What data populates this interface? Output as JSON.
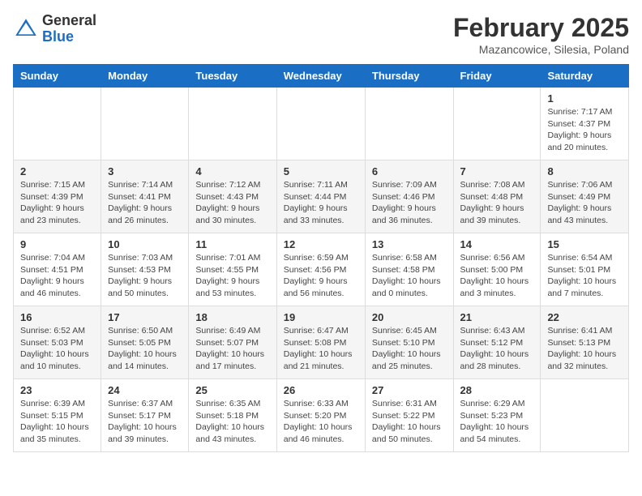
{
  "header": {
    "logo_general": "General",
    "logo_blue": "Blue",
    "month_title": "February 2025",
    "location": "Mazancowice, Silesia, Poland"
  },
  "weekdays": [
    "Sunday",
    "Monday",
    "Tuesday",
    "Wednesday",
    "Thursday",
    "Friday",
    "Saturday"
  ],
  "weeks": [
    [
      {
        "day": "",
        "text": ""
      },
      {
        "day": "",
        "text": ""
      },
      {
        "day": "",
        "text": ""
      },
      {
        "day": "",
        "text": ""
      },
      {
        "day": "",
        "text": ""
      },
      {
        "day": "",
        "text": ""
      },
      {
        "day": "1",
        "text": "Sunrise: 7:17 AM\nSunset: 4:37 PM\nDaylight: 9 hours and 20 minutes."
      }
    ],
    [
      {
        "day": "2",
        "text": "Sunrise: 7:15 AM\nSunset: 4:39 PM\nDaylight: 9 hours and 23 minutes."
      },
      {
        "day": "3",
        "text": "Sunrise: 7:14 AM\nSunset: 4:41 PM\nDaylight: 9 hours and 26 minutes."
      },
      {
        "day": "4",
        "text": "Sunrise: 7:12 AM\nSunset: 4:43 PM\nDaylight: 9 hours and 30 minutes."
      },
      {
        "day": "5",
        "text": "Sunrise: 7:11 AM\nSunset: 4:44 PM\nDaylight: 9 hours and 33 minutes."
      },
      {
        "day": "6",
        "text": "Sunrise: 7:09 AM\nSunset: 4:46 PM\nDaylight: 9 hours and 36 minutes."
      },
      {
        "day": "7",
        "text": "Sunrise: 7:08 AM\nSunset: 4:48 PM\nDaylight: 9 hours and 39 minutes."
      },
      {
        "day": "8",
        "text": "Sunrise: 7:06 AM\nSunset: 4:49 PM\nDaylight: 9 hours and 43 minutes."
      }
    ],
    [
      {
        "day": "9",
        "text": "Sunrise: 7:04 AM\nSunset: 4:51 PM\nDaylight: 9 hours and 46 minutes."
      },
      {
        "day": "10",
        "text": "Sunrise: 7:03 AM\nSunset: 4:53 PM\nDaylight: 9 hours and 50 minutes."
      },
      {
        "day": "11",
        "text": "Sunrise: 7:01 AM\nSunset: 4:55 PM\nDaylight: 9 hours and 53 minutes."
      },
      {
        "day": "12",
        "text": "Sunrise: 6:59 AM\nSunset: 4:56 PM\nDaylight: 9 hours and 56 minutes."
      },
      {
        "day": "13",
        "text": "Sunrise: 6:58 AM\nSunset: 4:58 PM\nDaylight: 10 hours and 0 minutes."
      },
      {
        "day": "14",
        "text": "Sunrise: 6:56 AM\nSunset: 5:00 PM\nDaylight: 10 hours and 3 minutes."
      },
      {
        "day": "15",
        "text": "Sunrise: 6:54 AM\nSunset: 5:01 PM\nDaylight: 10 hours and 7 minutes."
      }
    ],
    [
      {
        "day": "16",
        "text": "Sunrise: 6:52 AM\nSunset: 5:03 PM\nDaylight: 10 hours and 10 minutes."
      },
      {
        "day": "17",
        "text": "Sunrise: 6:50 AM\nSunset: 5:05 PM\nDaylight: 10 hours and 14 minutes."
      },
      {
        "day": "18",
        "text": "Sunrise: 6:49 AM\nSunset: 5:07 PM\nDaylight: 10 hours and 17 minutes."
      },
      {
        "day": "19",
        "text": "Sunrise: 6:47 AM\nSunset: 5:08 PM\nDaylight: 10 hours and 21 minutes."
      },
      {
        "day": "20",
        "text": "Sunrise: 6:45 AM\nSunset: 5:10 PM\nDaylight: 10 hours and 25 minutes."
      },
      {
        "day": "21",
        "text": "Sunrise: 6:43 AM\nSunset: 5:12 PM\nDaylight: 10 hours and 28 minutes."
      },
      {
        "day": "22",
        "text": "Sunrise: 6:41 AM\nSunset: 5:13 PM\nDaylight: 10 hours and 32 minutes."
      }
    ],
    [
      {
        "day": "23",
        "text": "Sunrise: 6:39 AM\nSunset: 5:15 PM\nDaylight: 10 hours and 35 minutes."
      },
      {
        "day": "24",
        "text": "Sunrise: 6:37 AM\nSunset: 5:17 PM\nDaylight: 10 hours and 39 minutes."
      },
      {
        "day": "25",
        "text": "Sunrise: 6:35 AM\nSunset: 5:18 PM\nDaylight: 10 hours and 43 minutes."
      },
      {
        "day": "26",
        "text": "Sunrise: 6:33 AM\nSunset: 5:20 PM\nDaylight: 10 hours and 46 minutes."
      },
      {
        "day": "27",
        "text": "Sunrise: 6:31 AM\nSunset: 5:22 PM\nDaylight: 10 hours and 50 minutes."
      },
      {
        "day": "28",
        "text": "Sunrise: 6:29 AM\nSunset: 5:23 PM\nDaylight: 10 hours and 54 minutes."
      },
      {
        "day": "",
        "text": ""
      }
    ]
  ]
}
